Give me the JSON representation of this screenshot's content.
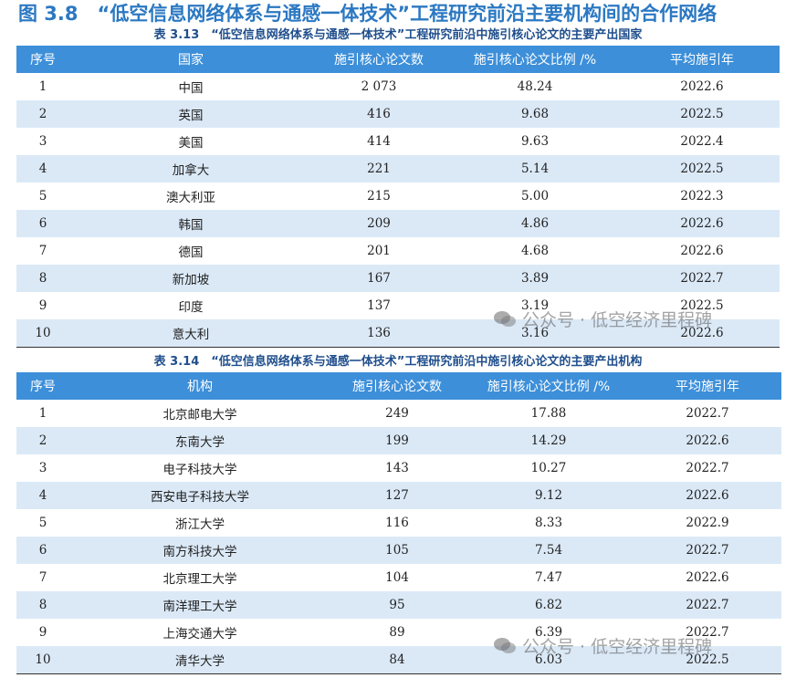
{
  "figure_title": "图 3.8　“低空信息网络体系与通感一体技术”工程研究前沿主要机构间的合作网络",
  "watermark": "公众号 · 低空经济里程碑",
  "table1": {
    "caption": "表 3.13　“低空信息网络体系与通感一体技术”工程研究前沿中施引核心论文的主要产出国家",
    "headers": [
      "序号",
      "国家",
      "施引核心论文数",
      "施引核心论文比例 /%",
      "平均施引年"
    ],
    "rows": [
      [
        "1",
        "中国",
        "2 073",
        "48.24",
        "2022.6"
      ],
      [
        "2",
        "英国",
        "416",
        "9.68",
        "2022.5"
      ],
      [
        "3",
        "美国",
        "414",
        "9.63",
        "2022.4"
      ],
      [
        "4",
        "加拿大",
        "221",
        "5.14",
        "2022.5"
      ],
      [
        "5",
        "澳大利亚",
        "215",
        "5.00",
        "2022.3"
      ],
      [
        "6",
        "韩国",
        "209",
        "4.86",
        "2022.6"
      ],
      [
        "7",
        "德国",
        "201",
        "4.68",
        "2022.6"
      ],
      [
        "8",
        "新加坡",
        "167",
        "3.89",
        "2022.7"
      ],
      [
        "9",
        "印度",
        "137",
        "3.19",
        "2022.5"
      ],
      [
        "10",
        "意大利",
        "136",
        "3.16",
        "2022.6"
      ]
    ]
  },
  "table2": {
    "caption": "表 3.14　“低空信息网络体系与通感一体技术”工程研究前沿中施引核心论文的主要产出机构",
    "headers": [
      "序号",
      "机构",
      "施引核心论文数",
      "施引核心论文比例 /%",
      "平均施引年"
    ],
    "rows": [
      [
        "1",
        "北京邮电大学",
        "249",
        "17.88",
        "2022.7"
      ],
      [
        "2",
        "东南大学",
        "199",
        "14.29",
        "2022.6"
      ],
      [
        "3",
        "电子科技大学",
        "143",
        "10.27",
        "2022.7"
      ],
      [
        "4",
        "西安电子科技大学",
        "127",
        "9.12",
        "2022.6"
      ],
      [
        "5",
        "浙江大学",
        "116",
        "8.33",
        "2022.9"
      ],
      [
        "6",
        "南方科技大学",
        "105",
        "7.54",
        "2022.7"
      ],
      [
        "7",
        "北京理工大学",
        "104",
        "7.47",
        "2022.6"
      ],
      [
        "8",
        "南洋理工大学",
        "95",
        "6.82",
        "2022.7"
      ],
      [
        "9",
        "上海交通大学",
        "89",
        "6.39",
        "2022.7"
      ],
      [
        "10",
        "清华大学",
        "84",
        "6.03",
        "2022.5"
      ]
    ]
  }
}
